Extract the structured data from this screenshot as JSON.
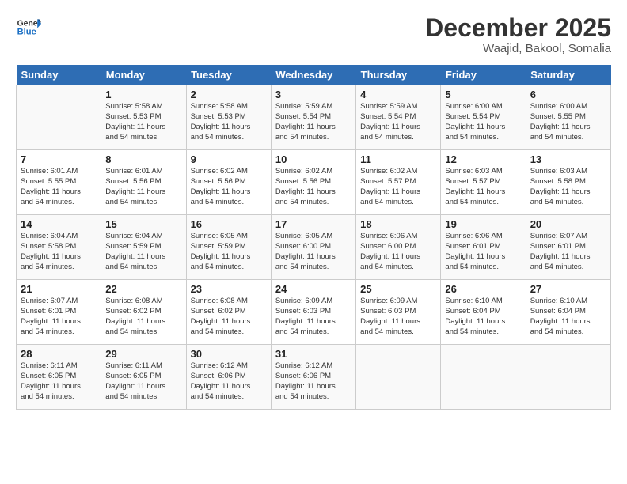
{
  "header": {
    "logo_general": "General",
    "logo_blue": "Blue",
    "month_title": "December 2025",
    "location": "Waajid, Bakool, Somalia"
  },
  "days_of_week": [
    "Sunday",
    "Monday",
    "Tuesday",
    "Wednesday",
    "Thursday",
    "Friday",
    "Saturday"
  ],
  "weeks": [
    [
      {
        "day": "",
        "info": ""
      },
      {
        "day": "1",
        "info": "Sunrise: 5:58 AM\nSunset: 5:53 PM\nDaylight: 11 hours\nand 54 minutes."
      },
      {
        "day": "2",
        "info": "Sunrise: 5:58 AM\nSunset: 5:53 PM\nDaylight: 11 hours\nand 54 minutes."
      },
      {
        "day": "3",
        "info": "Sunrise: 5:59 AM\nSunset: 5:54 PM\nDaylight: 11 hours\nand 54 minutes."
      },
      {
        "day": "4",
        "info": "Sunrise: 5:59 AM\nSunset: 5:54 PM\nDaylight: 11 hours\nand 54 minutes."
      },
      {
        "day": "5",
        "info": "Sunrise: 6:00 AM\nSunset: 5:54 PM\nDaylight: 11 hours\nand 54 minutes."
      },
      {
        "day": "6",
        "info": "Sunrise: 6:00 AM\nSunset: 5:55 PM\nDaylight: 11 hours\nand 54 minutes."
      }
    ],
    [
      {
        "day": "7",
        "info": "Sunrise: 6:01 AM\nSunset: 5:55 PM\nDaylight: 11 hours\nand 54 minutes."
      },
      {
        "day": "8",
        "info": "Sunrise: 6:01 AM\nSunset: 5:56 PM\nDaylight: 11 hours\nand 54 minutes."
      },
      {
        "day": "9",
        "info": "Sunrise: 6:02 AM\nSunset: 5:56 PM\nDaylight: 11 hours\nand 54 minutes."
      },
      {
        "day": "10",
        "info": "Sunrise: 6:02 AM\nSunset: 5:56 PM\nDaylight: 11 hours\nand 54 minutes."
      },
      {
        "day": "11",
        "info": "Sunrise: 6:02 AM\nSunset: 5:57 PM\nDaylight: 11 hours\nand 54 minutes."
      },
      {
        "day": "12",
        "info": "Sunrise: 6:03 AM\nSunset: 5:57 PM\nDaylight: 11 hours\nand 54 minutes."
      },
      {
        "day": "13",
        "info": "Sunrise: 6:03 AM\nSunset: 5:58 PM\nDaylight: 11 hours\nand 54 minutes."
      }
    ],
    [
      {
        "day": "14",
        "info": "Sunrise: 6:04 AM\nSunset: 5:58 PM\nDaylight: 11 hours\nand 54 minutes."
      },
      {
        "day": "15",
        "info": "Sunrise: 6:04 AM\nSunset: 5:59 PM\nDaylight: 11 hours\nand 54 minutes."
      },
      {
        "day": "16",
        "info": "Sunrise: 6:05 AM\nSunset: 5:59 PM\nDaylight: 11 hours\nand 54 minutes."
      },
      {
        "day": "17",
        "info": "Sunrise: 6:05 AM\nSunset: 6:00 PM\nDaylight: 11 hours\nand 54 minutes."
      },
      {
        "day": "18",
        "info": "Sunrise: 6:06 AM\nSunset: 6:00 PM\nDaylight: 11 hours\nand 54 minutes."
      },
      {
        "day": "19",
        "info": "Sunrise: 6:06 AM\nSunset: 6:01 PM\nDaylight: 11 hours\nand 54 minutes."
      },
      {
        "day": "20",
        "info": "Sunrise: 6:07 AM\nSunset: 6:01 PM\nDaylight: 11 hours\nand 54 minutes."
      }
    ],
    [
      {
        "day": "21",
        "info": "Sunrise: 6:07 AM\nSunset: 6:01 PM\nDaylight: 11 hours\nand 54 minutes."
      },
      {
        "day": "22",
        "info": "Sunrise: 6:08 AM\nSunset: 6:02 PM\nDaylight: 11 hours\nand 54 minutes."
      },
      {
        "day": "23",
        "info": "Sunrise: 6:08 AM\nSunset: 6:02 PM\nDaylight: 11 hours\nand 54 minutes."
      },
      {
        "day": "24",
        "info": "Sunrise: 6:09 AM\nSunset: 6:03 PM\nDaylight: 11 hours\nand 54 minutes."
      },
      {
        "day": "25",
        "info": "Sunrise: 6:09 AM\nSunset: 6:03 PM\nDaylight: 11 hours\nand 54 minutes."
      },
      {
        "day": "26",
        "info": "Sunrise: 6:10 AM\nSunset: 6:04 PM\nDaylight: 11 hours\nand 54 minutes."
      },
      {
        "day": "27",
        "info": "Sunrise: 6:10 AM\nSunset: 6:04 PM\nDaylight: 11 hours\nand 54 minutes."
      }
    ],
    [
      {
        "day": "28",
        "info": "Sunrise: 6:11 AM\nSunset: 6:05 PM\nDaylight: 11 hours\nand 54 minutes."
      },
      {
        "day": "29",
        "info": "Sunrise: 6:11 AM\nSunset: 6:05 PM\nDaylight: 11 hours\nand 54 minutes."
      },
      {
        "day": "30",
        "info": "Sunrise: 6:12 AM\nSunset: 6:06 PM\nDaylight: 11 hours\nand 54 minutes."
      },
      {
        "day": "31",
        "info": "Sunrise: 6:12 AM\nSunset: 6:06 PM\nDaylight: 11 hours\nand 54 minutes."
      },
      {
        "day": "",
        "info": ""
      },
      {
        "day": "",
        "info": ""
      },
      {
        "day": "",
        "info": ""
      }
    ]
  ]
}
